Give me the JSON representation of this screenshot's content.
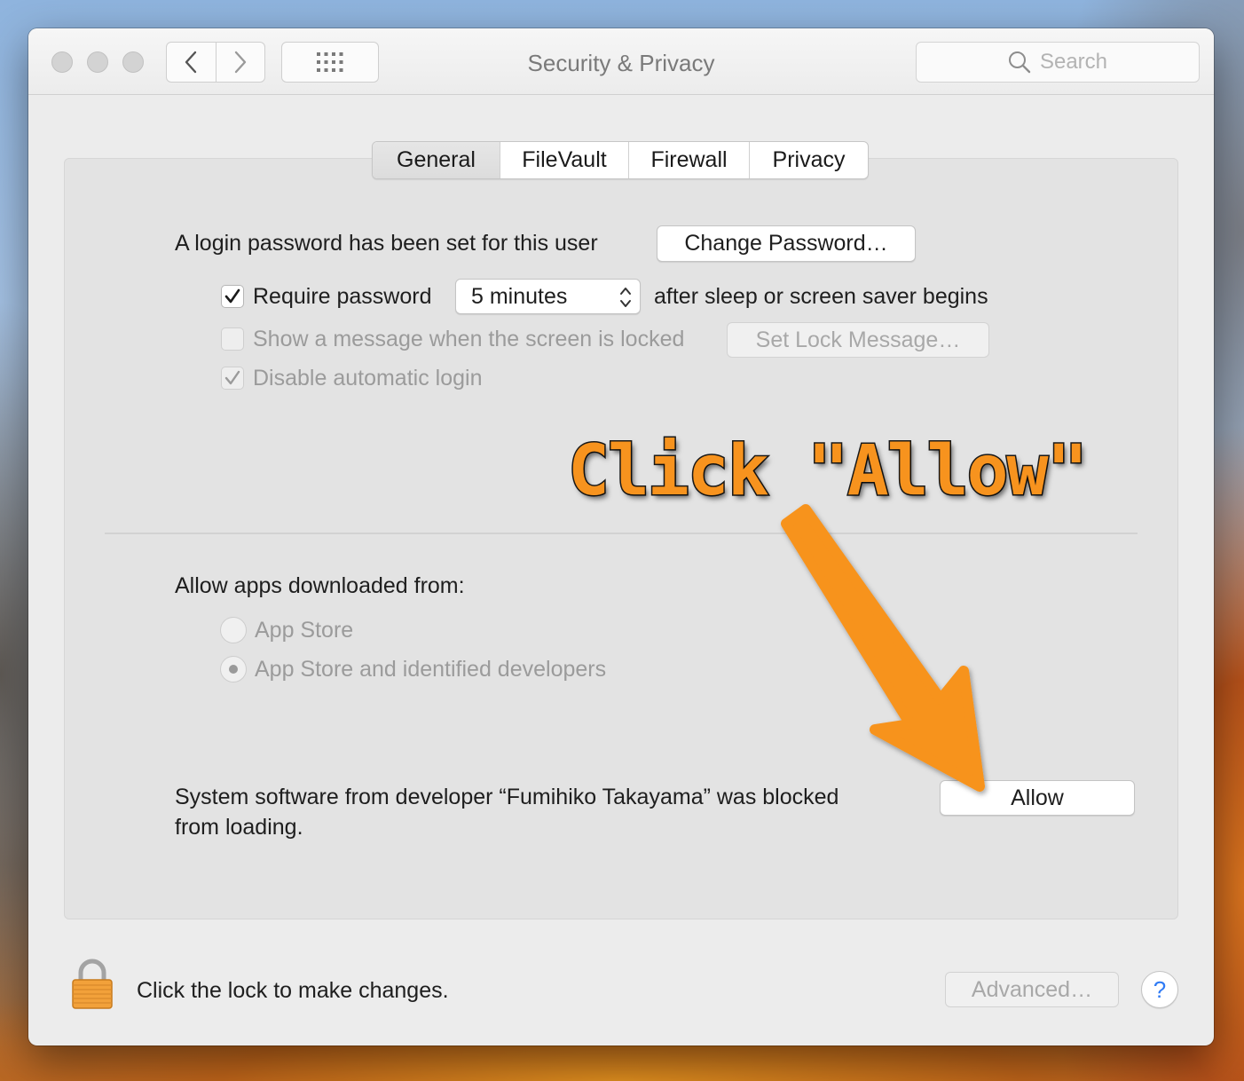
{
  "window": {
    "title": "Security & Privacy",
    "search_placeholder": "Search"
  },
  "tabs": [
    {
      "label": "General",
      "selected": true
    },
    {
      "label": "FileVault",
      "selected": false
    },
    {
      "label": "Firewall",
      "selected": false
    },
    {
      "label": "Privacy",
      "selected": false
    }
  ],
  "general": {
    "login_password_text": "A login password has been set for this user",
    "change_password_button": "Change Password…",
    "require_password": {
      "label": "Require password",
      "checked": true
    },
    "require_password_delay": "5 minutes",
    "after_sleep_text": "after sleep or screen saver begins",
    "show_message": {
      "label": "Show a message when the screen is locked",
      "checked": false,
      "enabled": false
    },
    "set_lock_message_button": "Set Lock Message…",
    "disable_auto_login": {
      "label": "Disable automatic login",
      "checked": true,
      "enabled": false
    }
  },
  "allow_apps": {
    "heading": "Allow apps downloaded from:",
    "options": [
      {
        "label": "App Store",
        "selected": false,
        "enabled": false
      },
      {
        "label": "App Store and identified developers",
        "selected": true,
        "enabled": false
      }
    ]
  },
  "blocked": {
    "line1": "System software from developer “Fumihiko Takayama” was blocked",
    "line2": "from loading.",
    "allow_button": "Allow"
  },
  "footer": {
    "lock_text": "Click the lock to make changes.",
    "advanced_button": "Advanced…",
    "help_button": "?"
  },
  "annotation": {
    "text": "Click \"Allow\"",
    "color": "#f7931e"
  },
  "colors": {
    "window_bg": "#ececec",
    "panel_bg": "#e3e3e3",
    "lock_body": "#f2a13a"
  }
}
